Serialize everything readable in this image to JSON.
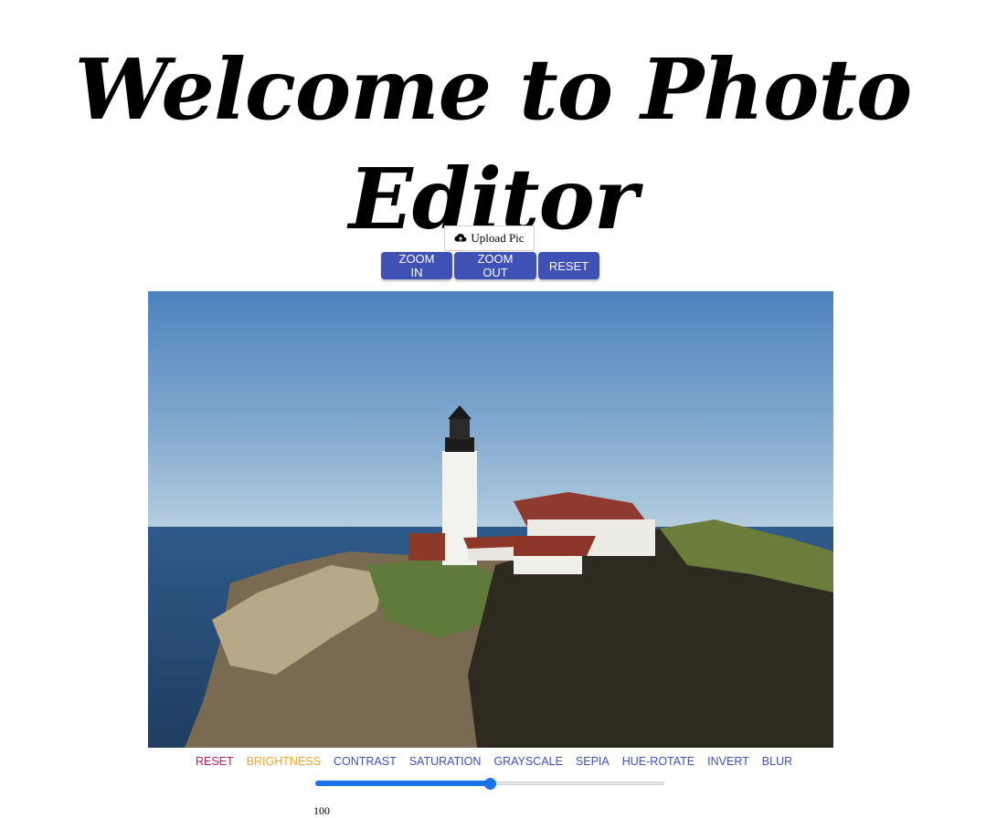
{
  "header": {
    "title": "Welcome to Photo Editor"
  },
  "upload": {
    "label": "Upload Pic",
    "icon": "cloud-upload-icon"
  },
  "zoom_buttons": {
    "zoom_in": "ZOOM IN",
    "zoom_out": "ZOOM OUT",
    "reset": "RESET"
  },
  "filters": [
    {
      "label": "RESET",
      "color": "#c2185b"
    },
    {
      "label": "BRIGHTNESS",
      "color": "#f5a623"
    },
    {
      "label": "CONTRAST",
      "color": "#3f51b5"
    },
    {
      "label": "SATURATION",
      "color": "#3f51b5"
    },
    {
      "label": "GRAYSCALE",
      "color": "#3f51b5"
    },
    {
      "label": "SEPIA",
      "color": "#3f51b5"
    },
    {
      "label": "HUE-ROTATE",
      "color": "#3f51b5"
    },
    {
      "label": "INVERT",
      "color": "#3f51b5"
    },
    {
      "label": "BLUR",
      "color": "#3f51b5"
    }
  ],
  "slider": {
    "value": 100,
    "max": 200,
    "value_label": "100"
  },
  "colors": {
    "button": "#3f51b5",
    "slider": "#1a73e8"
  }
}
